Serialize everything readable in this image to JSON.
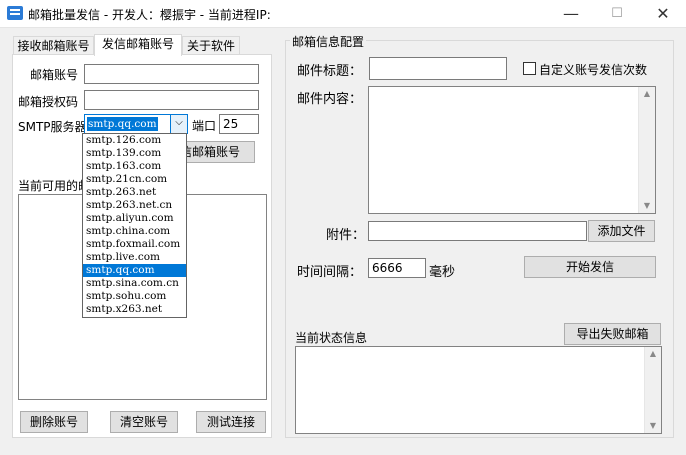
{
  "window": {
    "title": "邮箱批量发信 - 开发人：樱振宇 - 当前进程IP:",
    "minimize": "—",
    "maximize": "☐",
    "close": "✕"
  },
  "tabs": [
    {
      "label": "接收邮箱账号"
    },
    {
      "label": "发信邮箱账号"
    },
    {
      "label": "关于软件"
    }
  ],
  "left": {
    "email_label": "邮箱账号",
    "email_value": "",
    "auth_label": "邮箱授权码",
    "auth_value": "",
    "smtp_label": "SMTP服务器",
    "smtp_value": "smtp.qq.com",
    "port_label": "端口",
    "port_value": "25",
    "add_button_partial": "信邮箱账号",
    "available_label_partial": "当前可用的邮",
    "delete_button": "删除账号",
    "clear_button": "清空账号",
    "test_button": "测试连接"
  },
  "smtp_options": [
    "smtp.126.com",
    "smtp.139.com",
    "smtp.163.com",
    "smtp.21cn.com",
    "smtp.263.net",
    "smtp.263.net.cn",
    "smtp.aliyun.com",
    "smtp.china.com",
    "smtp.foxmail.com",
    "smtp.live.com",
    "smtp.qq.com",
    "smtp.sina.com.cn",
    "smtp.sohu.com",
    "smtp.x263.net"
  ],
  "right": {
    "group_title": "邮箱信息配置",
    "subject_label": "邮件标题：",
    "subject_value": "",
    "custom_count_label": "自定义账号发信次数",
    "content_label": "邮件内容：",
    "attach_label": "附件：",
    "attach_value": "",
    "add_file_button": "添加文件",
    "interval_label": "时间间隔：",
    "interval_value": "6666",
    "interval_unit": "毫秒",
    "start_button": "开始发信",
    "status_label": "当前状态信息",
    "export_button": "导出失败邮箱"
  }
}
